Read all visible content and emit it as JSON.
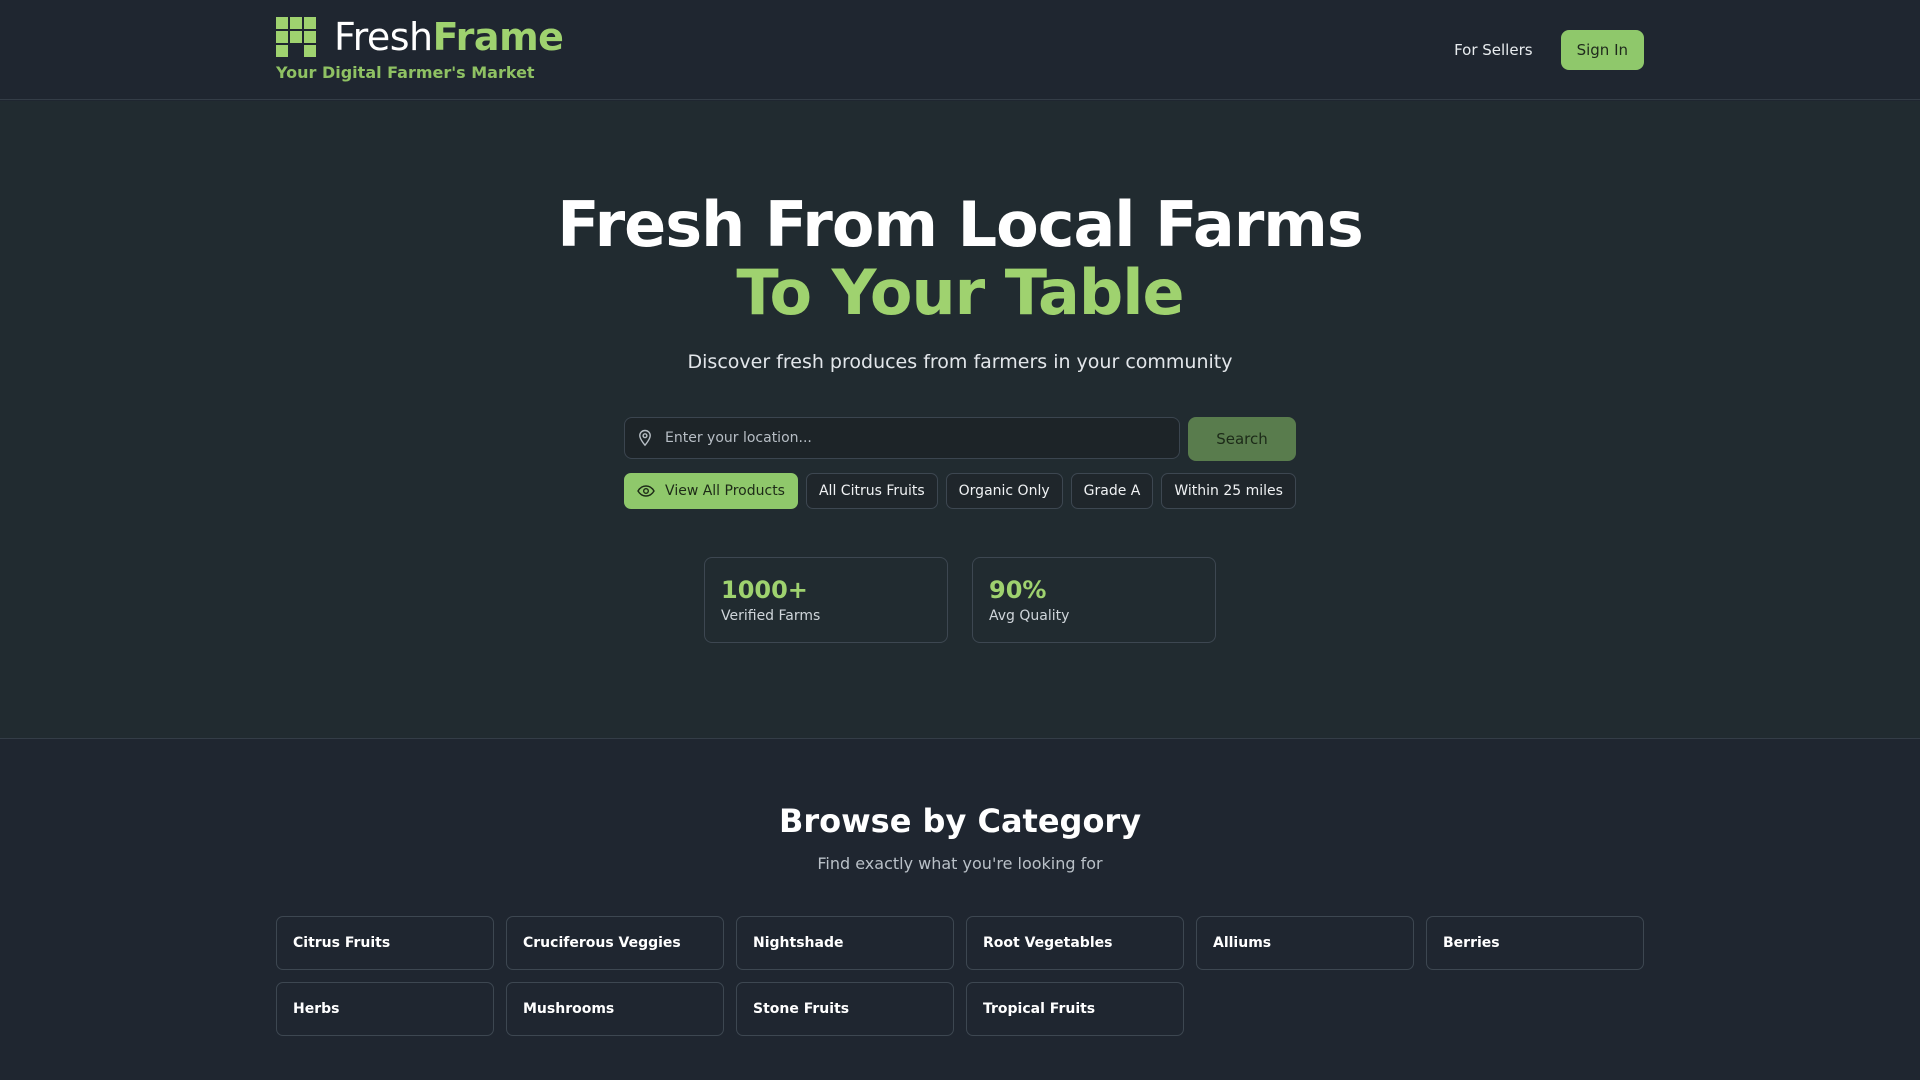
{
  "header": {
    "logo_part1": "Fresh",
    "logo_part2": "Frame",
    "tagline": "Your Digital Farmer's Market",
    "nav_link": "For Sellers",
    "signin_label": "Sign In"
  },
  "hero": {
    "title_line1": "Fresh From Local Farms",
    "title_line2": "To Your Table",
    "subtitle": "Discover fresh produces from farmers in your community",
    "search_placeholder": "Enter your location...",
    "search_button": "Search",
    "filters": [
      {
        "label": "View All Products",
        "active": true,
        "icon": "eye-icon"
      },
      {
        "label": "All Citrus Fruits"
      },
      {
        "label": "Organic Only"
      },
      {
        "label": "Grade A"
      },
      {
        "label": "Within 25 miles"
      }
    ],
    "stats": [
      {
        "value": "1000+",
        "label": "Verified Farms"
      },
      {
        "value": "90%",
        "label": "Avg Quality"
      }
    ]
  },
  "browse": {
    "title": "Browse by Category",
    "subtitle": "Find exactly what you're looking for",
    "categories": [
      "Citrus Fruits",
      "Cruciferous Veggies",
      "Nightshade",
      "Root Vegetables",
      "Alliums",
      "Berries",
      "Herbs",
      "Mushrooms",
      "Stone Fruits",
      "Tropical Fruits"
    ]
  },
  "colors": {
    "accent": "#8fc86b",
    "accent_text": "#9fd26f",
    "bg": "#1f2630",
    "hero_bg": "#212b30"
  },
  "icons": [
    "logo-mark-icon",
    "location-pin-icon",
    "eye-icon"
  ]
}
